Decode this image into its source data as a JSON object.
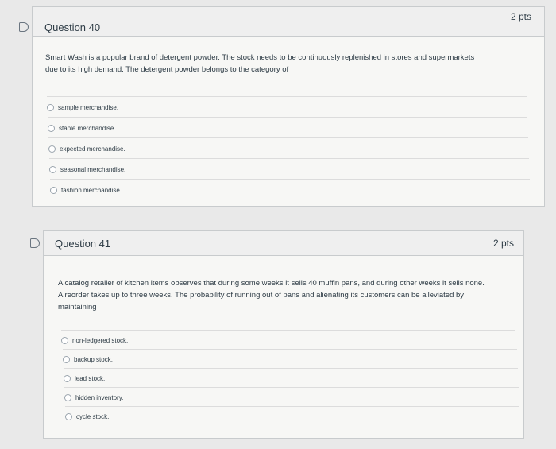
{
  "questions": [
    {
      "title": "Question 40",
      "points": "2 pts",
      "text_line1": "Smart Wash is a popular brand of detergent powder. The stock needs to be continuously replenished in stores and supermarkets",
      "text_line2": "due to its high demand. The detergent powder belongs to the category of",
      "options": [
        "sample merchandise.",
        "staple merchandise.",
        "expected merchandise.",
        "seasonal merchandise.",
        "fashion merchandise."
      ]
    },
    {
      "title": "Question 41",
      "points": "2 pts",
      "text_line1": "A catalog retailer of kitchen items observes that during some weeks it sells 40 muffin pans, and during other weeks it sells none.",
      "text_line2": "A reorder takes up to three weeks. The probability of running out of pans and alienating its customers can be alleviated by",
      "text_line3": "maintaining",
      "options": [
        "non-ledgered stock.",
        "backup stock.",
        "lead stock.",
        "hidden inventory.",
        "cycle stock."
      ]
    }
  ]
}
